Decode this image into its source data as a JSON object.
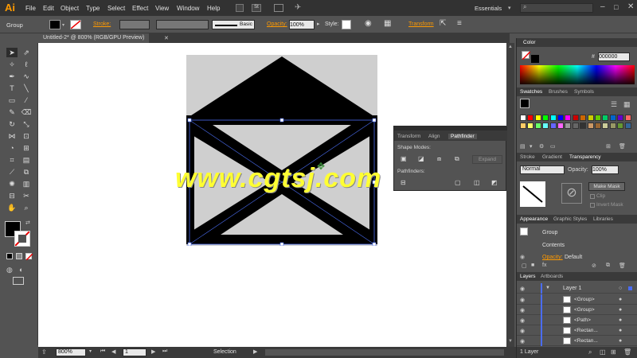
{
  "menu": {
    "logo": "Ai",
    "items": [
      "File",
      "Edit",
      "Object",
      "Type",
      "Select",
      "Effect",
      "View",
      "Window",
      "Help"
    ],
    "workspace": "Essentials",
    "search_placeholder": ""
  },
  "control": {
    "selection_label": "Group",
    "stroke_label": "Stroke:",
    "brush_label": "Basic",
    "opacity_label": "Opacity:",
    "opacity_value": "100%",
    "style_label": "Style:",
    "transform_label": "Transform"
  },
  "document": {
    "tab_title": "Untitled-2* @ 800% (RGB/GPU Preview)"
  },
  "status": {
    "zoom": "800%",
    "artboard": "1",
    "tool": "Selection"
  },
  "colors": {
    "accent": "#ff9a00",
    "selection": "#4a6cf0",
    "artboard_bg": "#cfcfcf",
    "envelope": "#000000",
    "watermark": "#ffff33"
  },
  "watermark": "www.cgtsj.com",
  "color_panel": {
    "title": "Color",
    "hex": "000000"
  },
  "swatches_panel": {
    "tabs": [
      "Swatches",
      "Brushes",
      "Symbols"
    ]
  },
  "stroke_panel": {
    "tabs": [
      "Stroke",
      "Gradient",
      "Transparency"
    ],
    "blend_mode": "Normal",
    "opacity_label": "Opacity:",
    "opacity_value": "100%",
    "make_mask": "Make Mask",
    "clip": "Clip",
    "invert_mask": "Invert Mask"
  },
  "appearance_panel": {
    "tabs": [
      "Appearance",
      "Graphic Styles",
      "Libraries"
    ],
    "rows": [
      "Group",
      "Contents"
    ],
    "opacity_row": "Opacity:",
    "opacity_value": "Default"
  },
  "layers_panel": {
    "tabs": [
      "Layers",
      "Artboards"
    ],
    "layer_name": "Layer 1",
    "items": [
      "<Group>",
      "<Group>",
      "<Path>",
      "<Rectan...",
      "<Rectan..."
    ],
    "footer": "1 Layer"
  },
  "pathfinder_panel": {
    "tabs": [
      "Transform",
      "Align",
      "Pathfinder"
    ],
    "shape_modes": "Shape Modes:",
    "pathfinders": "Pathfinders:",
    "expand": "Expand"
  }
}
